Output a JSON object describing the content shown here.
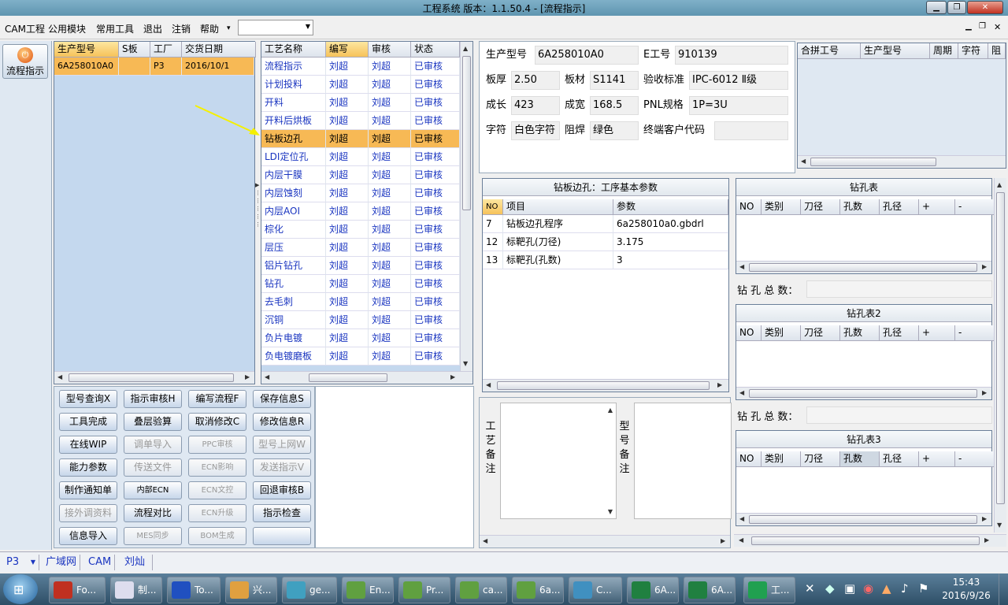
{
  "window": {
    "title": "工程系统   版本：1.1.50.4 - [流程指示]"
  },
  "menu": [
    "CAM工程",
    "公用模块",
    "常用工具",
    "退出",
    "注销",
    "帮助"
  ],
  "menu_more": "▾",
  "leftbar": {
    "flow_button": "流程指示"
  },
  "models_table": {
    "headers": [
      "生产型号",
      "S板",
      "工厂",
      "交货日期"
    ],
    "rows": [
      [
        "6A258010A0",
        "",
        "P3",
        "2016/10/1"
      ]
    ]
  },
  "process_table": {
    "headers": [
      "工艺名称",
      "编写",
      "审核",
      "状态"
    ],
    "rows": [
      [
        "流程指示",
        "刘超",
        "刘超",
        "已审核"
      ],
      [
        "计划投料",
        "刘超",
        "刘超",
        "已审核"
      ],
      [
        "开料",
        "刘超",
        "刘超",
        "已审核"
      ],
      [
        "开料后烘板",
        "刘超",
        "刘超",
        "已审核"
      ],
      [
        "钻板边孔",
        "刘超",
        "刘超",
        "已审核"
      ],
      [
        "LDI定位孔",
        "刘超",
        "刘超",
        "已审核"
      ],
      [
        "内层干膜",
        "刘超",
        "刘超",
        "已审核"
      ],
      [
        "内层蚀刻",
        "刘超",
        "刘超",
        "已审核"
      ],
      [
        "内层AOI",
        "刘超",
        "刘超",
        "已审核"
      ],
      [
        "棕化",
        "刘超",
        "刘超",
        "已审核"
      ],
      [
        "层压",
        "刘超",
        "刘超",
        "已审核"
      ],
      [
        "铝片钻孔",
        "刘超",
        "刘超",
        "已审核"
      ],
      [
        "钻孔",
        "刘超",
        "刘超",
        "已审核"
      ],
      [
        "去毛刺",
        "刘超",
        "刘超",
        "已审核"
      ],
      [
        "沉铜",
        "刘超",
        "刘超",
        "已审核"
      ],
      [
        "负片电镀",
        "刘超",
        "刘超",
        "已审核"
      ],
      [
        "负电镀磨板",
        "刘超",
        "刘超",
        "已审核"
      ]
    ],
    "selected_index": 4
  },
  "buttons": [
    [
      "型号查询X",
      "指示审核H",
      "编写流程F",
      "保存信息S"
    ],
    [
      "工具完成",
      "叠层验算",
      "取消修改C",
      "修改信息R"
    ],
    [
      "在线WIP",
      "调单导入",
      "PPC审核",
      "型号上网W"
    ],
    [
      "能力参数",
      "传送文件",
      "ECN影响",
      "发送指示V"
    ],
    [
      "制作通知单",
      "内部ECN",
      "ECN文控",
      "回退审核B"
    ],
    [
      "接外调资料",
      "流程对比",
      "ECN升级",
      "指示检查"
    ],
    [
      "信息导入",
      "MES同步",
      "BOM生成",
      ""
    ]
  ],
  "disabled_buttons": [
    "调单导入",
    "PPC审核",
    "型号上网W",
    "传送文件",
    "ECN影响",
    "发送指示V",
    "ECN文控",
    "接外调资料",
    "ECN升级",
    "MES同步",
    "BOM生成"
  ],
  "info": {
    "model_label": "生产型号",
    "model": "6A258010A0",
    "e_label": "E工号",
    "e_no": "910139",
    "thick_label": "板厚",
    "thick": "2.50",
    "mat_label": "板材",
    "mat": "S1141",
    "std_label": "验收标准",
    "std": "IPC-6012 Ⅱ级",
    "len_label": "成长",
    "len": "423",
    "wid_label": "成宽",
    "wid": "168.5",
    "pnl_label": "PNL规格",
    "pnl": "1P=3U",
    "char_label": "字符",
    "char": "白色字符",
    "mask_label": "阻焊",
    "mask": "绿色",
    "cust_label": "终端客户代码",
    "cust": ""
  },
  "merge_table": {
    "headers": [
      "合拼工号",
      "生产型号",
      "周期",
      "字符",
      "阻焊"
    ]
  },
  "param_table": {
    "title": "钻板边孔：工序基本参数",
    "headers": [
      "NO",
      "项目",
      "参数"
    ],
    "rows": [
      [
        "7",
        "钻板边孔程序",
        "6a258010a0.gbdrl"
      ],
      [
        "12",
        "标靶孔(刀径)",
        "3.175"
      ],
      [
        "13",
        "标靶孔(孔数)",
        "3"
      ]
    ]
  },
  "drill_tables": [
    {
      "title": "钻孔表",
      "headers": [
        "NO",
        "类别",
        "刀径",
        "孔数",
        "孔径",
        "+",
        "-"
      ],
      "total_label": "钻 孔 总 数："
    },
    {
      "title": "钻孔表2",
      "headers": [
        "NO",
        "类别",
        "刀径",
        "孔数",
        "孔径",
        "+",
        "-"
      ],
      "total_label": "钻 孔 总 数："
    },
    {
      "title": "钻孔表3",
      "headers": [
        "NO",
        "类别",
        "刀径",
        "孔数",
        "孔径",
        "+",
        "-"
      ]
    }
  ],
  "remarks": {
    "process": "工艺备注",
    "model": "型号备注"
  },
  "status": {
    "factory": "P3",
    "net": "广域网",
    "cam": "CAM",
    "user": "刘灿"
  },
  "taskbar": {
    "items": [
      "Fo...",
      "制...",
      "To...",
      "兴...",
      "ge...",
      "En...",
      "Pr...",
      "ca...",
      "6a...",
      "C...",
      "6A...",
      "6A...",
      "工..."
    ],
    "time": "15:43",
    "date": "2016/9/26"
  },
  "colors": {
    "accent": "#f7b955",
    "link": "#1a35c0"
  }
}
